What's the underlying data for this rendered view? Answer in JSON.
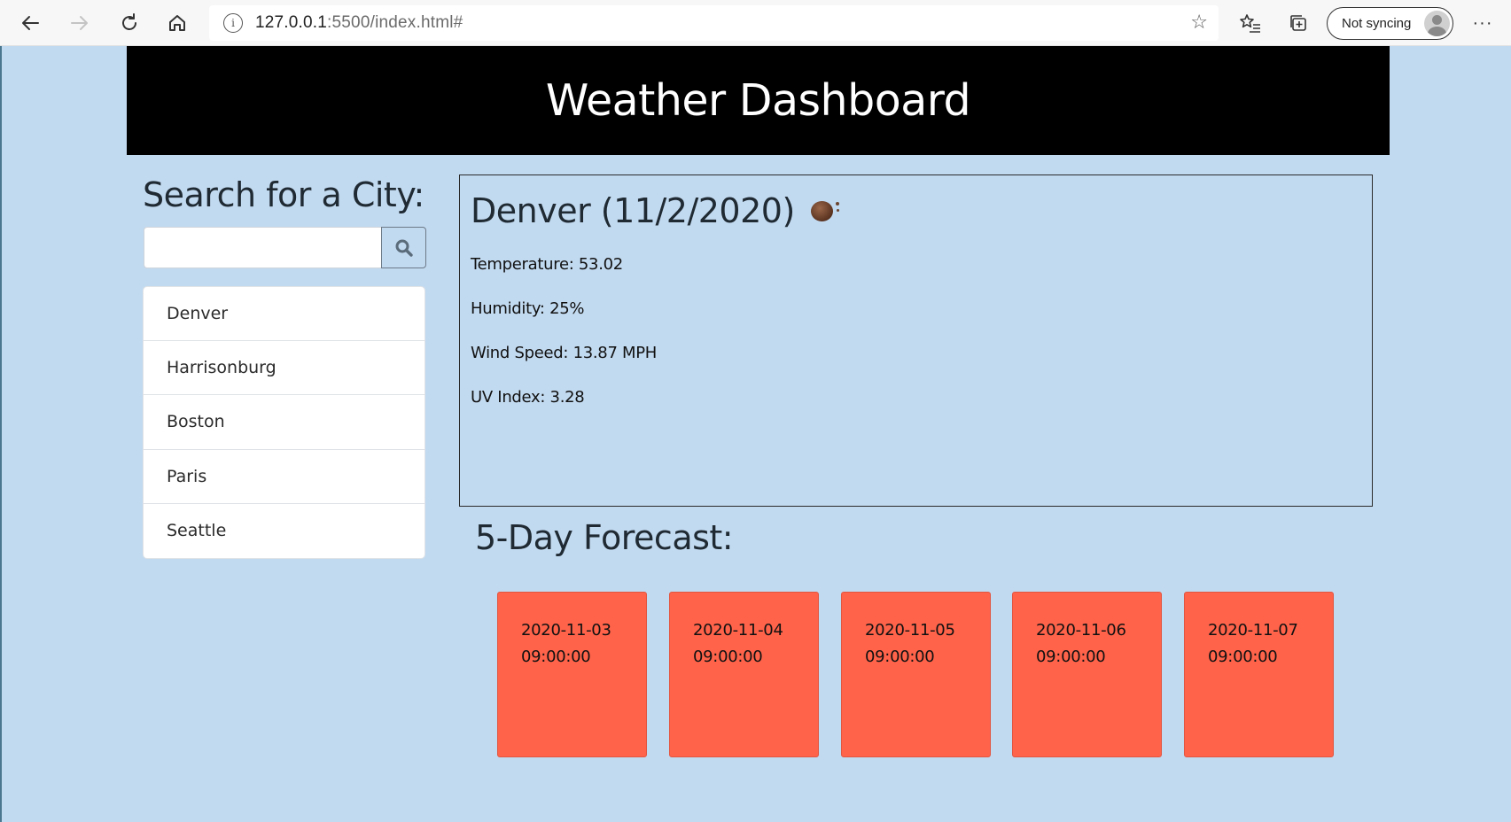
{
  "browser": {
    "url_host": "127.0.0.1",
    "url_rest": ":5500/index.html#",
    "sync_label": "Not syncing"
  },
  "header": {
    "title": "Weather Dashboard"
  },
  "search": {
    "heading": "Search for a City:",
    "input_value": "",
    "placeholder": ""
  },
  "cities": [
    "Denver",
    "Harrisonburg",
    "Boston",
    "Paris",
    "Seattle"
  ],
  "current": {
    "title": "Denver (11/2/2020)",
    "temperature": "Temperature: 53.02",
    "humidity": "Humidity: 25%",
    "wind": "Wind Speed: 13.87 MPH",
    "uv": "UV Index: 3.28"
  },
  "forecast": {
    "heading": "5-Day Forecast:",
    "days": [
      {
        "date": "2020-11-03",
        "time": "09:00:00"
      },
      {
        "date": "2020-11-04",
        "time": "09:00:00"
      },
      {
        "date": "2020-11-05",
        "time": "09:00:00"
      },
      {
        "date": "2020-11-06",
        "time": "09:00:00"
      },
      {
        "date": "2020-11-07",
        "time": "09:00:00"
      }
    ]
  },
  "colors": {
    "page_bg": "#c2daf0",
    "header_bg": "#000000",
    "forecast_card": "#ff634a"
  },
  "icons": {
    "back": "arrow-left-icon",
    "forward": "arrow-right-icon",
    "refresh": "refresh-icon",
    "home": "home-icon",
    "info": "info-icon",
    "favorite": "star-icon",
    "favorites": "favorites-icon",
    "collections": "collections-icon",
    "more": "more-icon",
    "search": "search-icon",
    "weather": "weather-icon"
  }
}
